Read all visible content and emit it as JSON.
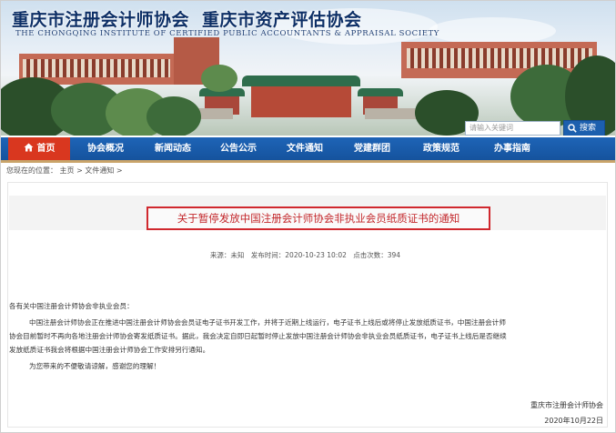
{
  "header": {
    "title_cn_1": "重庆市注册会计师协会",
    "title_cn_2": "重庆市资产评估协会",
    "title_en": "THE CHONGQING INSTITUTE OF CERTIFIED PUBLIC ACCOUNTANTS & APPRAISAL SOCIETY"
  },
  "search": {
    "placeholder": "请输入关键词",
    "button_label": "搜索"
  },
  "nav": {
    "items": [
      {
        "label": "首页",
        "active": true
      },
      {
        "label": "协会概况"
      },
      {
        "label": "新闻动态"
      },
      {
        "label": "公告公示"
      },
      {
        "label": "文件通知"
      },
      {
        "label": "党建群团"
      },
      {
        "label": "政策规范"
      },
      {
        "label": "办事指南"
      }
    ]
  },
  "breadcrumb": {
    "prefix": "您现在的位置：",
    "home": "主页",
    "sep": ">",
    "section": "文件通知",
    "trail": ">"
  },
  "article": {
    "title": "关于暂停发放中国注册会计师协会非执业会员纸质证书的通知",
    "meta": {
      "source": "来源：未知",
      "published": "发布时间：2020-10-23 10:02",
      "views": "点击次数：394"
    },
    "salutation": "各有关中国注册会计师协会非执业会员：",
    "paragraph_lines": [
      "中国注册会计师协会正在推进中国注册会计师协会会员证电子证书开发工作，并将于近期上线运行，电子证书上线后或将停止发放纸质证书，中国注册会计师",
      "协会目前暂时不再向各地注册会计师协会寄发纸质证书。据此，我会决定自即日起暂时停止发放中国注册会计师协会非执业会员纸质证书，电子证书上线后是否继续",
      "发放纸质证书我会将根据中国注册会计师协会工作安排另行通知。"
    ],
    "closing": "为您带来的不便敬请谅解，感谢您的理解！",
    "signature": "重庆市注册会计师协会",
    "date": "2020年10月22日"
  },
  "colors": {
    "nav_blue": "#1c5fae",
    "home_red": "#d9371f",
    "title_red": "#c3282c"
  }
}
